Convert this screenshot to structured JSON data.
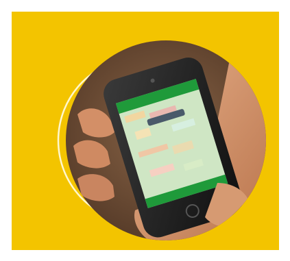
{
  "colors": {
    "page_background": "#ffffff",
    "panel_background": "#f3c400",
    "ring": "#fff7cc",
    "photo_background": "#6b4a33",
    "hand": "#d99a72",
    "phone_body": "#1f1f1f",
    "screen_header": "#1f9a3a",
    "screen_map": "#cfe6c4"
  },
  "icons": [
    "hand-holding-phone-photo",
    "smartphone-map-app"
  ]
}
